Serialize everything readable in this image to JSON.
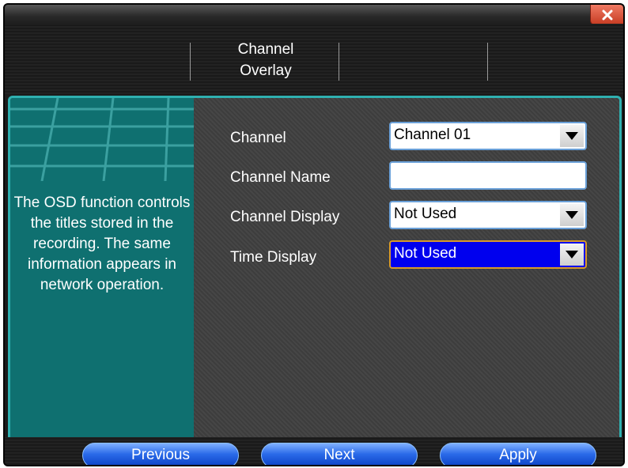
{
  "tabs": [
    {
      "label": "Channel\nOverlay"
    }
  ],
  "info": {
    "text": "The OSD function controls the titles stored in the recording. The same information appears in network operation."
  },
  "form": {
    "channel": {
      "label": "Channel",
      "value": "Channel 01"
    },
    "channel_name": {
      "label": "Channel Name",
      "value": ""
    },
    "channel_display": {
      "label": "Channel Display",
      "value": "Not Used"
    },
    "time_display": {
      "label": "Time Display",
      "value": "Not Used"
    }
  },
  "buttons": {
    "previous": "Previous",
    "next": "Next",
    "apply": "Apply"
  },
  "colors": {
    "accent_teal": "#0f7070",
    "border_teal": "#2fb0b0",
    "focus_blue": "#0000ee",
    "close_red": "#d64a30"
  },
  "icons": {
    "close": "close-icon",
    "dropdown": "chevron-down-icon"
  }
}
